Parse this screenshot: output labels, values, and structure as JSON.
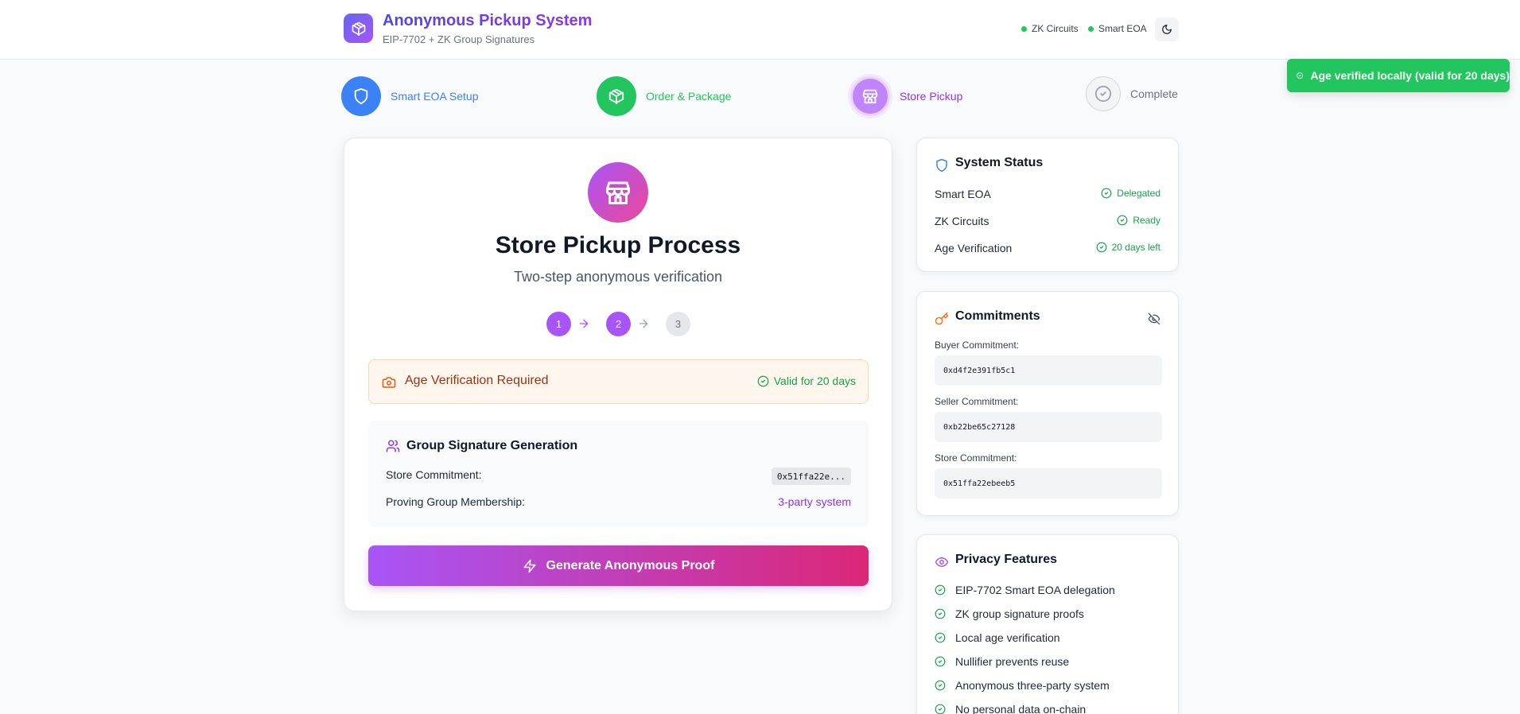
{
  "header": {
    "title": "Anonymous Pickup System",
    "subtitle": "EIP-7702 + ZK Group Signatures",
    "status": [
      "ZK Circuits",
      "Smart EOA"
    ]
  },
  "toast": {
    "message": "Age verified locally (valid for 20 days)"
  },
  "steps": [
    {
      "label": "Smart EOA Setup",
      "state": "done"
    },
    {
      "label": "Order & Package",
      "state": "done"
    },
    {
      "label": "Store Pickup",
      "state": "active"
    },
    {
      "label": "Complete",
      "state": "pending"
    }
  ],
  "main": {
    "title": "Store Pickup Process",
    "subtitle": "Two-step anonymous verification",
    "mini_steps": [
      "1",
      "2",
      "3"
    ],
    "age_box": {
      "title": "Age Verification Required",
      "valid": "Valid for 20 days"
    },
    "group": {
      "title": "Group Signature Generation",
      "store_label": "Store Commitment:",
      "store_value": "0x51ffa22e...",
      "proving_label": "Proving Group Membership:",
      "proving_value": "3-party system"
    },
    "button": "Generate Anonymous Proof"
  },
  "system_status": {
    "title": "System Status",
    "rows": [
      {
        "label": "Smart EOA",
        "value": "Delegated"
      },
      {
        "label": "ZK Circuits",
        "value": "Ready"
      },
      {
        "label": "Age Verification",
        "value": "20 days left"
      }
    ]
  },
  "commitments": {
    "title": "Commitments",
    "items": [
      {
        "label": "Buyer Commitment:",
        "value": "0xd4f2e391fb5c1"
      },
      {
        "label": "Seller Commitment:",
        "value": "0xb22be65c27128"
      },
      {
        "label": "Store Commitment:",
        "value": "0x51ffa22ebeeb5"
      }
    ]
  },
  "privacy": {
    "title": "Privacy Features",
    "items": [
      "EIP-7702 Smart EOA delegation",
      "ZK group signature proofs",
      "Local age verification",
      "Nullifier prevents reuse",
      "Anonymous three-party system",
      "No personal data on-chain"
    ]
  }
}
